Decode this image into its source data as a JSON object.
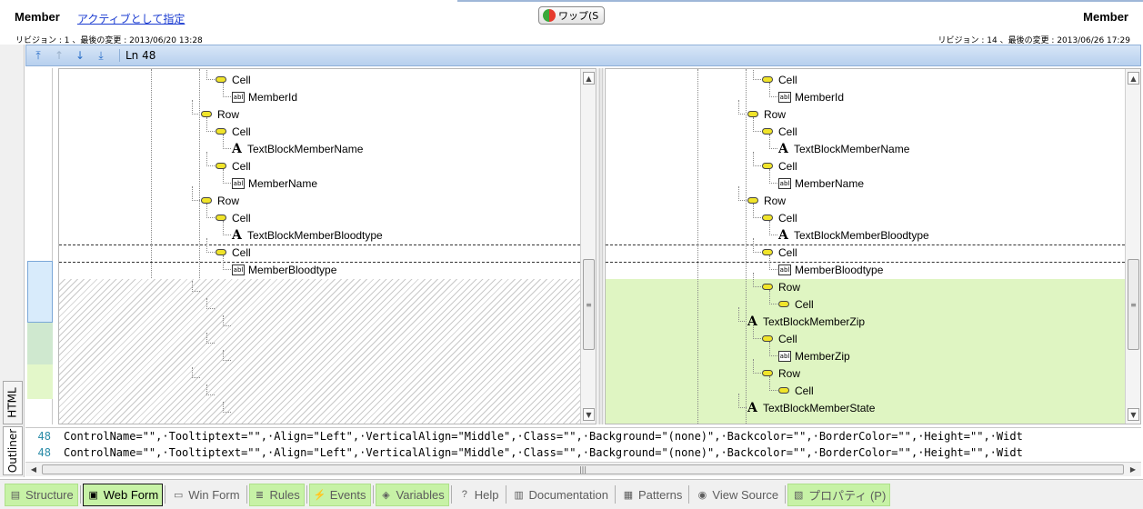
{
  "header": {
    "left_title": "Member",
    "left_link": "アクティブとして指定",
    "swap_label": "ワップ(S",
    "right_title": "Member",
    "left_revision": "リビジョン : 1 、最後の変更 : 2013/06/20 13:28",
    "right_revision": "リビジョン : 14 、最後の変更 : 2013/06/26 17:29"
  },
  "toolbar": {
    "line_label": "Ln 48",
    "icons": [
      "first-diff-icon",
      "prev-diff-icon",
      "next-diff-icon",
      "last-diff-icon"
    ]
  },
  "side_tabs": {
    "html": "HTML",
    "outliner": "Outliner"
  },
  "left_tree": [
    {
      "label": "Cell",
      "kind": "pill"
    },
    {
      "label": "MemberId",
      "kind": "abl"
    },
    {
      "label": "Row",
      "kind": "pill"
    },
    {
      "label": "Cell",
      "kind": "pill"
    },
    {
      "label": "TextBlockMemberName",
      "kind": "text"
    },
    {
      "label": "Cell",
      "kind": "pill"
    },
    {
      "label": "MemberName",
      "kind": "abl"
    },
    {
      "label": "Row",
      "kind": "pill"
    },
    {
      "label": "Cell",
      "kind": "pill"
    },
    {
      "label": "TextBlockMemberBloodtype",
      "kind": "text"
    },
    {
      "label": "Cell",
      "kind": "pill"
    },
    {
      "label": "MemberBloodtype",
      "kind": "abl"
    }
  ],
  "right_tree": [
    {
      "label": "Cell",
      "kind": "pill"
    },
    {
      "label": "MemberId",
      "kind": "abl"
    },
    {
      "label": "Row",
      "kind": "pill"
    },
    {
      "label": "Cell",
      "kind": "pill"
    },
    {
      "label": "TextBlockMemberName",
      "kind": "text"
    },
    {
      "label": "Cell",
      "kind": "pill"
    },
    {
      "label": "MemberName",
      "kind": "abl"
    },
    {
      "label": "Row",
      "kind": "pill"
    },
    {
      "label": "Cell",
      "kind": "pill"
    },
    {
      "label": "TextBlockMemberBloodtype",
      "kind": "text"
    },
    {
      "label": "Cell",
      "kind": "pill"
    },
    {
      "label": "MemberBloodtype",
      "kind": "abl"
    },
    {
      "label": "Row",
      "kind": "pill"
    },
    {
      "label": "Cell",
      "kind": "pill"
    },
    {
      "label": "TextBlockMemberZip",
      "kind": "text"
    },
    {
      "label": "Cell",
      "kind": "pill"
    },
    {
      "label": "MemberZip",
      "kind": "abl"
    },
    {
      "label": "Row",
      "kind": "pill"
    },
    {
      "label": "Cell",
      "kind": "pill"
    },
    {
      "label": "TextBlockMemberState",
      "kind": "text"
    }
  ],
  "source_lines": [
    {
      "num": "48",
      "text": "ControlName=\"\",·Tooltiptext=\"\",·Align=\"Left\",·VerticalAlign=\"Middle\",·Class=\"\",·Background=\"(none)\",·Backcolor=\"\",·BorderColor=\"\",·Height=\"\",·Widt"
    },
    {
      "num": "48",
      "text": "ControlName=\"\",·Tooltiptext=\"\",·Align=\"Left\",·VerticalAlign=\"Middle\",·Class=\"\",·Background=\"(none)\",·Backcolor=\"\",·BorderColor=\"\",·Height=\"\",·Widt"
    }
  ],
  "bottom_tabs": [
    {
      "label": "Structure",
      "icon": "structure-icon",
      "style": "green"
    },
    {
      "label": "Web Form",
      "icon": "web-form-icon",
      "style": "active"
    },
    {
      "label": "Win Form",
      "icon": "win-form-icon",
      "style": "plain"
    },
    {
      "label": "Rules",
      "icon": "rules-icon",
      "style": "green"
    },
    {
      "label": "Events",
      "icon": "events-icon",
      "style": "green"
    },
    {
      "label": "Variables",
      "icon": "variables-icon",
      "style": "green"
    },
    {
      "label": "Help",
      "icon": "help-icon",
      "style": "plain"
    },
    {
      "label": "Documentation",
      "icon": "documentation-icon",
      "style": "plain"
    },
    {
      "label": "Patterns",
      "icon": "patterns-icon",
      "style": "plain"
    },
    {
      "label": "View Source",
      "icon": "view-source-icon",
      "style": "plain"
    },
    {
      "label": "プロパティ (P)",
      "icon": "properties-icon",
      "style": "green"
    }
  ],
  "colors": {
    "link": "#1a3bd1",
    "added": "#dff5c2",
    "tab_green": "#c7f2a6",
    "toolbar": "#c4daf2",
    "line_number": "#2b8ca8"
  }
}
